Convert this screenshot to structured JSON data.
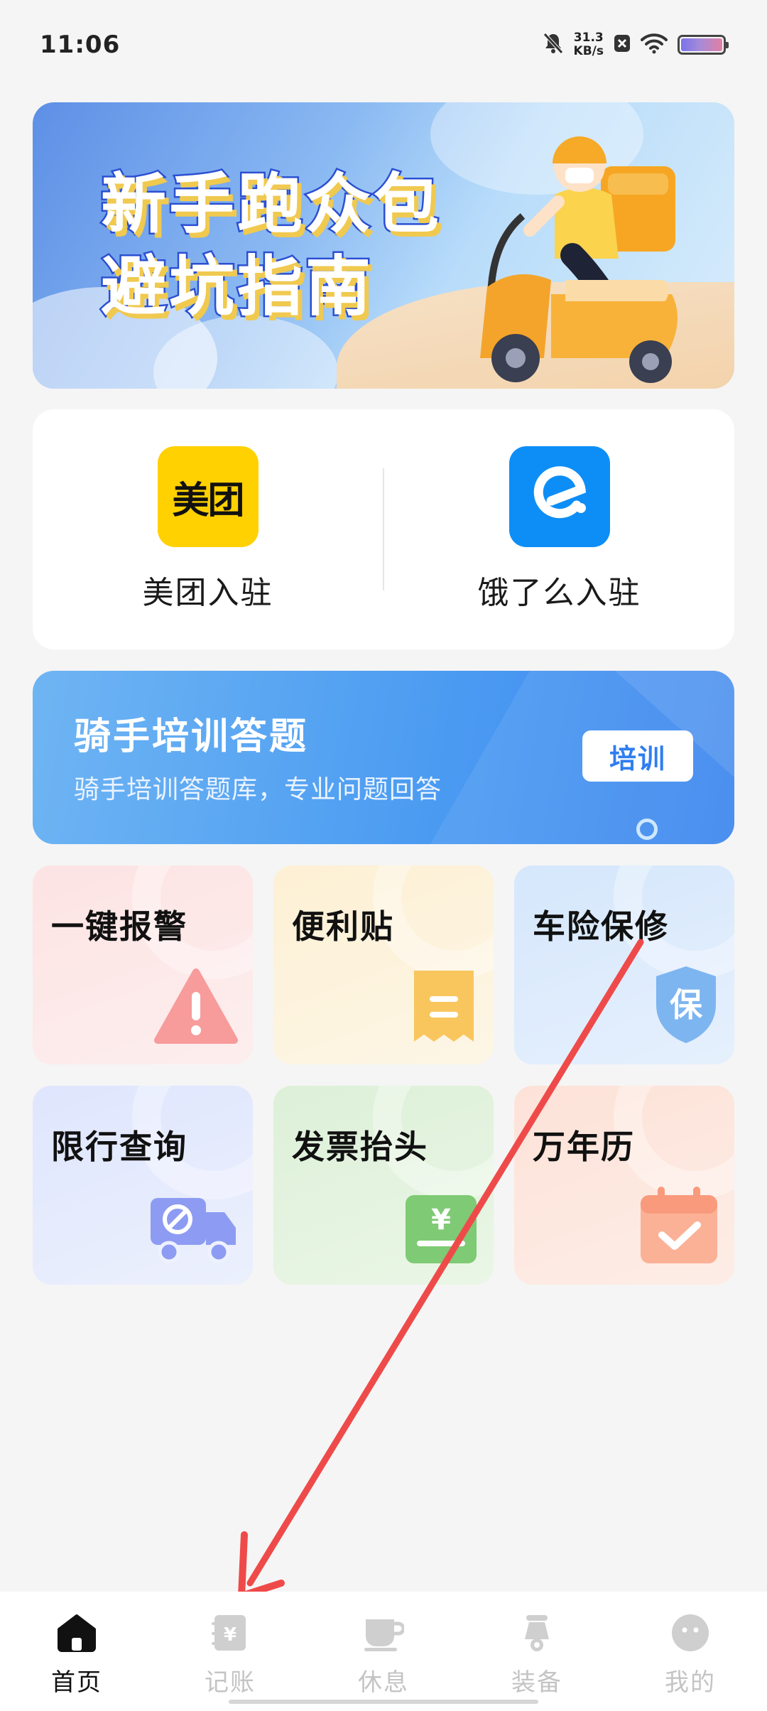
{
  "status_bar": {
    "time": "11:06",
    "net_speed_value": "31.3",
    "net_speed_unit": "KB/s",
    "icons": [
      "mute-bell-icon",
      "close-box-icon",
      "wifi-icon",
      "battery-icon"
    ]
  },
  "banner": {
    "line1": "新手跑众包",
    "line2": "避坑指南",
    "colors": {
      "text_stroke": "#2b4fd1",
      "text_shadow": "#f0c94f"
    }
  },
  "platforms": [
    {
      "logo_text": "美团",
      "label": "美团入驻",
      "color": "#ffd100"
    },
    {
      "logo_icon": "eleme-logo-icon",
      "label": "饿了么入驻",
      "color": "#0d8ef7"
    }
  ],
  "training": {
    "title": "骑手培训答题",
    "subtitle": "骑手培训答题库，专业问题回答",
    "button": "培训"
  },
  "tools": [
    {
      "label": "一键报警",
      "icon": "warning-icon",
      "color": "#fde8e8"
    },
    {
      "label": "便利贴",
      "icon": "note-icon",
      "color": "#fdf3dc"
    },
    {
      "label": "车险保修",
      "icon": "shield-icon",
      "shield_char": "保",
      "color": "#dcebfc"
    },
    {
      "label": "限行查询",
      "icon": "restricted-truck-icon",
      "color": "#e3e9fd"
    },
    {
      "label": "发票抬头",
      "icon": "invoice-icon",
      "invoice_char": "¥",
      "color": "#e1f2dd"
    },
    {
      "label": "万年历",
      "icon": "calendar-check-icon",
      "color": "#fde6de"
    }
  ],
  "bottom_nav": [
    {
      "label": "首页",
      "icon": "home-icon",
      "active": true
    },
    {
      "label": "记账",
      "icon": "ledger-icon",
      "icon_char": "¥",
      "active": false
    },
    {
      "label": "休息",
      "icon": "coffee-cup-icon",
      "active": false
    },
    {
      "label": "装备",
      "icon": "scooter-icon",
      "active": false
    },
    {
      "label": "我的",
      "icon": "profile-face-icon",
      "active": false
    }
  ],
  "annotation": {
    "type": "arrow",
    "color": "#ef4a4a"
  }
}
